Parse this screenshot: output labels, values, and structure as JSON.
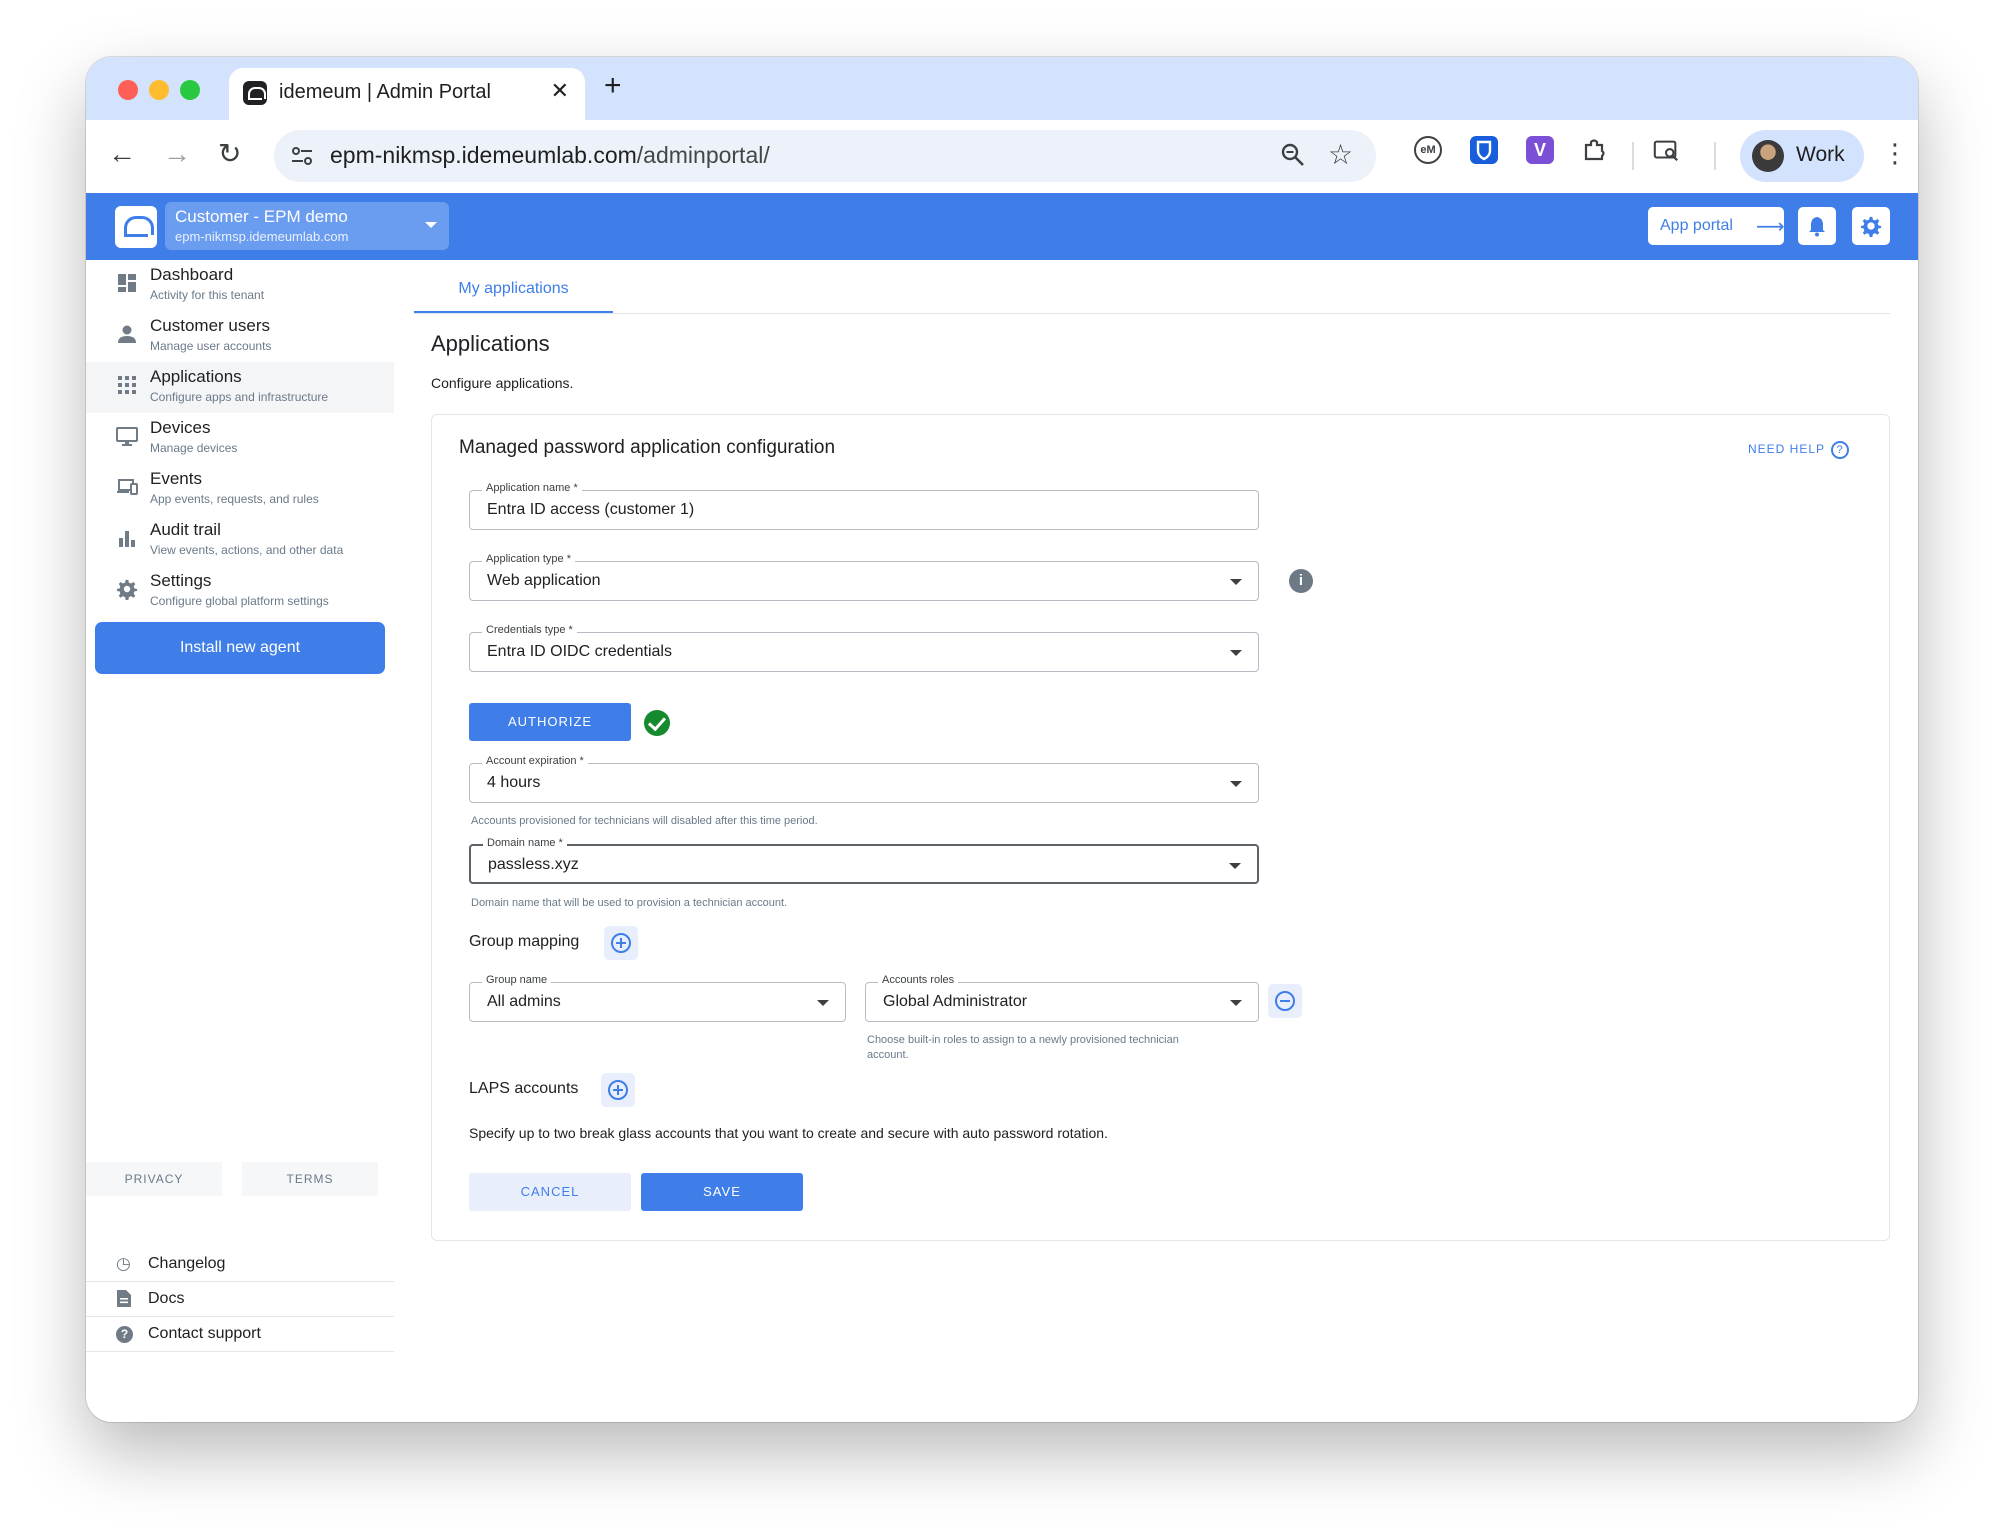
{
  "browser": {
    "tab_title": "idemeum | Admin Portal",
    "url_host": "epm-nikmsp.idemeumlab.com",
    "url_path": "/adminportal/",
    "profile_name": "Work"
  },
  "header": {
    "tenant_name": "Customer - EPM demo",
    "tenant_domain": "epm-nikmsp.idemeumlab.com",
    "app_portal_label": "App portal"
  },
  "sidebar": {
    "items": [
      {
        "label": "Dashboard",
        "sub": "Activity for this tenant",
        "icon": "dashboard-icon"
      },
      {
        "label": "Customer users",
        "sub": "Manage user accounts",
        "icon": "person-icon"
      },
      {
        "label": "Applications",
        "sub": "Configure apps and infrastructure",
        "icon": "apps-grid-icon"
      },
      {
        "label": "Devices",
        "sub": "Manage devices",
        "icon": "monitor-icon"
      },
      {
        "label": "Events",
        "sub": "App events, requests, and rules",
        "icon": "devices-icon"
      },
      {
        "label": "Audit trail",
        "sub": "View events, actions, and other data",
        "icon": "bar-chart-icon"
      },
      {
        "label": "Settings",
        "sub": "Configure global platform settings",
        "icon": "gear-icon"
      }
    ],
    "install_button": "Install new agent",
    "footer": [
      {
        "label": "Changelog",
        "icon": "history-icon"
      },
      {
        "label": "Docs",
        "icon": "document-icon"
      },
      {
        "label": "Contact support",
        "icon": "help-icon"
      }
    ],
    "privacy": "PRIVACY",
    "terms": "TERMS"
  },
  "main": {
    "tab": "My applications",
    "title": "Applications",
    "subtitle": "Configure applications.",
    "card": {
      "title": "Managed password application configuration",
      "need_help": "NEED HELP",
      "app_name": {
        "label": "Application name *",
        "value": "Entra ID access (customer 1)"
      },
      "app_type": {
        "label": "Application type *",
        "value": "Web application"
      },
      "cred_type": {
        "label": "Credentials type *",
        "value": "Entra ID OIDC credentials"
      },
      "authorize": "AUTHORIZE",
      "expiration": {
        "label": "Account expiration *",
        "value": "4 hours",
        "hint": "Accounts provisioned for technicians will disabled after this time period."
      },
      "domain": {
        "label": "Domain name *",
        "value": "passless.xyz",
        "hint": "Domain name that will be used to provision a technician account."
      },
      "group_mapping": "Group mapping",
      "group_name": {
        "label": "Group name",
        "value": "All admins"
      },
      "roles": {
        "label": "Accounts roles",
        "value": "Global Administrator",
        "hint": "Choose built-in roles to assign to a newly provisioned technician account."
      },
      "laps": "LAPS accounts",
      "laps_desc": "Specify up to two break glass accounts that you want to create and secure with auto password rotation.",
      "cancel": "CANCEL",
      "save": "SAVE"
    }
  }
}
